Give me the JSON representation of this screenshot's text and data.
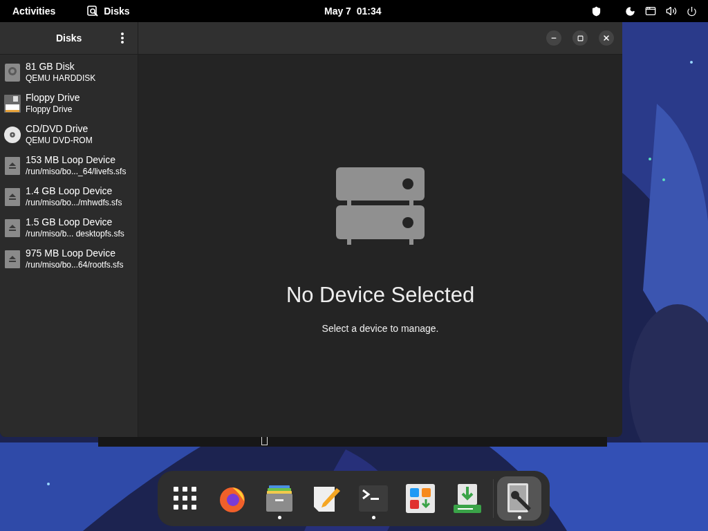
{
  "top_bar": {
    "activities": "Activities",
    "app_name": "Disks",
    "clock": "May 7  01:34"
  },
  "window": {
    "sidebar_title": "Disks",
    "devices": [
      {
        "kind": "harddisk",
        "name": "81 GB Disk",
        "detail": "QEMU HARDDISK"
      },
      {
        "kind": "floppy",
        "name": "Floppy Drive",
        "detail": "Floppy Drive"
      },
      {
        "kind": "optical",
        "name": "CD/DVD Drive",
        "detail": "QEMU DVD-ROM"
      },
      {
        "kind": "loop",
        "name": "153 MB Loop Device",
        "detail": "/run/miso/bo..._64/livefs.sfs"
      },
      {
        "kind": "loop",
        "name": "1.4 GB Loop Device",
        "detail": "/run/miso/bo.../mhwdfs.sfs"
      },
      {
        "kind": "loop",
        "name": "1.5 GB Loop Device",
        "detail": "/run/miso/b... desktopfs.sfs"
      },
      {
        "kind": "loop",
        "name": "975 MB Loop Device",
        "detail": "/run/miso/bo...64/rootfs.sfs"
      }
    ],
    "empty_title": "No Device Selected",
    "empty_text": "Select a device to manage."
  },
  "dock": [
    {
      "kind": "apps",
      "running": false,
      "selected": false
    },
    {
      "kind": "browser",
      "running": false,
      "selected": false
    },
    {
      "kind": "files",
      "running": true,
      "selected": false
    },
    {
      "kind": "editor",
      "running": false,
      "selected": false
    },
    {
      "kind": "terminal",
      "running": true,
      "selected": false
    },
    {
      "kind": "software",
      "running": false,
      "selected": false
    },
    {
      "kind": "installer",
      "running": false,
      "selected": false
    },
    {
      "kind": "disks",
      "running": true,
      "selected": true
    }
  ]
}
